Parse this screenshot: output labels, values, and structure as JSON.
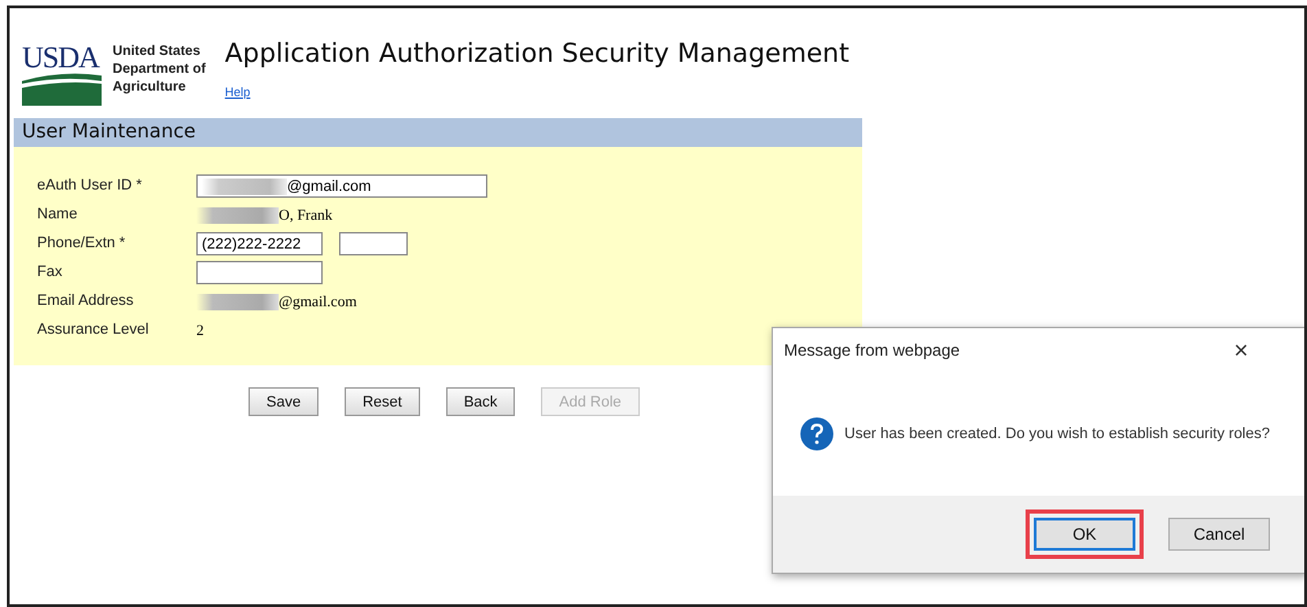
{
  "header": {
    "logo": {
      "mark": "USDA",
      "agency": [
        "United States",
        "Department of",
        "Agriculture"
      ]
    },
    "title": "Application Authorization Security Management",
    "help_link": "Help"
  },
  "section": {
    "title": "User Maintenance"
  },
  "fields": [
    {
      "label": "eAuth User ID *",
      "kind": "input",
      "value": "@gmail.com",
      "redacted": true
    },
    {
      "label": "Name",
      "kind": "text",
      "value": "O, Frank",
      "redacted": true
    },
    {
      "label": "Phone/Extn *",
      "kind": "phone",
      "value": "(222)222-2222",
      "redacted": false
    },
    {
      "label": "Fax",
      "kind": "input-short",
      "redacted": false
    },
    {
      "label": "Email Address",
      "kind": "text",
      "value": "@gmail.com",
      "redacted": true
    },
    {
      "label": "Assurance Level",
      "kind": "text",
      "value": "2",
      "redacted": false
    }
  ],
  "buttons": [
    {
      "label": "Save",
      "disabled": false
    },
    {
      "label": "Reset",
      "disabled": false
    },
    {
      "label": "Back",
      "disabled": false
    },
    {
      "label": "Add Role",
      "disabled": true
    }
  ],
  "dialog": {
    "title": "Message from webpage",
    "close": "×",
    "message": "User has been created. Do you wish to establish security roles?",
    "buttons": [
      {
        "label": "OK",
        "default": true,
        "highlighted": true
      },
      {
        "label": "Cancel",
        "default": false,
        "highlighted": false
      }
    ]
  }
}
